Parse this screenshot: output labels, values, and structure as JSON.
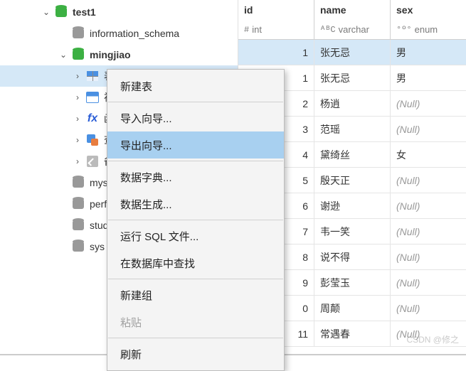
{
  "sidebar": {
    "items": [
      {
        "label": "test1",
        "level": 1,
        "icon": "db-green",
        "expanded": true,
        "bold": true,
        "hasChildren": true
      },
      {
        "label": "information_schema",
        "level": 2,
        "icon": "db-gray",
        "expanded": false,
        "hasChildren": false
      },
      {
        "label": "mingjiao",
        "level": 2,
        "icon": "db-green",
        "expanded": true,
        "bold": true,
        "hasChildren": true
      },
      {
        "label": "表",
        "level": 3,
        "icon": "tbl",
        "expanded": false,
        "hasChildren": true,
        "selected": true
      },
      {
        "label": "视图",
        "level": 3,
        "icon": "view",
        "expanded": false,
        "hasChildren": true
      },
      {
        "label": "函数",
        "level": 3,
        "icon": "fx",
        "expanded": false,
        "hasChildren": true
      },
      {
        "label": "查询",
        "level": 3,
        "icon": "qry",
        "expanded": false,
        "hasChildren": true
      },
      {
        "label": "备份",
        "level": 3,
        "icon": "bak",
        "expanded": false,
        "hasChildren": true
      },
      {
        "label": "mysql",
        "level": 2,
        "icon": "db-gray",
        "expanded": false,
        "hasChildren": false
      },
      {
        "label": "perfor",
        "level": 2,
        "icon": "db-gray",
        "expanded": false,
        "hasChildren": false
      },
      {
        "label": "studer",
        "level": 2,
        "icon": "db-gray",
        "expanded": false,
        "hasChildren": false
      },
      {
        "label": "sys",
        "level": 2,
        "icon": "db-gray",
        "expanded": false,
        "hasChildren": false
      }
    ]
  },
  "columns": [
    {
      "name": "id",
      "type_prefix": "#",
      "type": "int"
    },
    {
      "name": "name",
      "type_prefix": "ᴬᴮC",
      "type": "varchar"
    },
    {
      "name": "sex",
      "type_prefix": "°º°",
      "type": "enum"
    }
  ],
  "rows": [
    {
      "id": "1",
      "name": "张无忌",
      "sex": "男",
      "selected": true
    },
    {
      "id": "1",
      "name": "张无忌",
      "sex": "男"
    },
    {
      "id": "2",
      "name": "杨逍",
      "sex": "(Null)",
      "sexNull": true
    },
    {
      "id": "3",
      "name": "范瑶",
      "sex": "(Null)",
      "sexNull": true
    },
    {
      "id": "4",
      "name": "黛绮丝",
      "sex": "女"
    },
    {
      "id": "5",
      "name": "殷天正",
      "sex": "(Null)",
      "sexNull": true
    },
    {
      "id": "6",
      "name": "谢逊",
      "sex": "(Null)",
      "sexNull": true
    },
    {
      "id": "7",
      "name": "韦一笑",
      "sex": "(Null)",
      "sexNull": true
    },
    {
      "id": "8",
      "name": "说不得",
      "sex": "(Null)",
      "sexNull": true
    },
    {
      "id": "9",
      "name": "彭莹玉",
      "sex": "(Null)",
      "sexNull": true
    },
    {
      "id": "0",
      "name": "周颠",
      "sex": "(Null)",
      "sexNull": true
    },
    {
      "id": "11",
      "name": "常遇春",
      "sex": "(Null)",
      "sexNull": true
    }
  ],
  "contextMenu": {
    "items": [
      {
        "label": "新建表"
      },
      {
        "separator": true
      },
      {
        "label": "导入向导..."
      },
      {
        "label": "导出向导...",
        "highlighted": true
      },
      {
        "separator": true
      },
      {
        "label": "数据字典..."
      },
      {
        "label": "数据生成..."
      },
      {
        "separator": true
      },
      {
        "label": "运行 SQL 文件..."
      },
      {
        "label": "在数据库中查找"
      },
      {
        "separator": true
      },
      {
        "label": "新建组"
      },
      {
        "label": "粘贴",
        "disabled": true
      },
      {
        "separator": true
      },
      {
        "label": "刷新"
      }
    ]
  },
  "watermark": "CSDN @修之"
}
